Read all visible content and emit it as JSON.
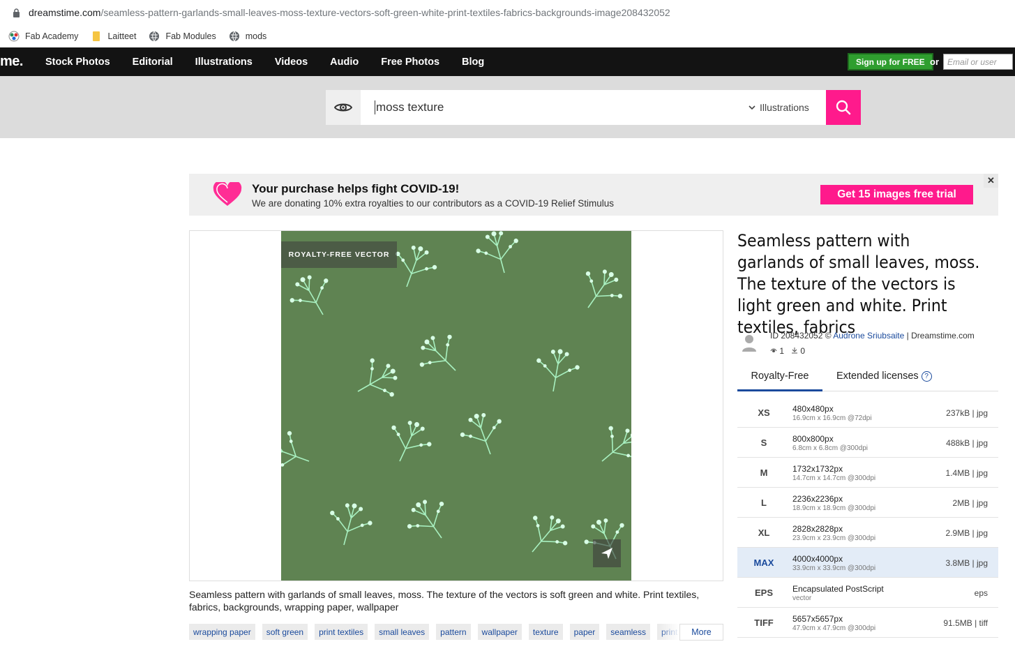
{
  "browser": {
    "url_host": "dreamstime.com",
    "url_path": "/seamless-pattern-garlands-small-leaves-moss-texture-vectors-soft-green-white-print-textiles-fabrics-backgrounds-image208432052",
    "bookmarks": [
      {
        "label": "Fab Academy",
        "icon": "fab-icon"
      },
      {
        "label": "Laitteet",
        "icon": "folder-icon"
      },
      {
        "label": "Fab Modules",
        "icon": "globe-icon"
      },
      {
        "label": "mods",
        "icon": "globe-icon"
      }
    ]
  },
  "nav": {
    "logo": "me.",
    "items": [
      "Stock Photos",
      "Editorial",
      "Illustrations",
      "Videos",
      "Audio",
      "Free Photos",
      "Blog"
    ],
    "signup_label": "Sign up for FREE",
    "or_label": "or",
    "email_placeholder": "Email or user"
  },
  "search": {
    "query": "moss texture",
    "category": "Illustrations"
  },
  "covid_banner": {
    "title": "Your purchase helps fight COVID-19!",
    "subtitle": "We are donating 10% extra royalties to our contributors as a COVID-19 Relief Stimulus",
    "cta": "Get 15 images free trial",
    "close": "✕"
  },
  "image": {
    "badge": "ROYALTY-FREE VECTOR",
    "caption": "Seamless pattern with garlands of small leaves, moss. The texture of the vectors is soft green and white. Print textiles, fabrics, backgrounds, wrapping paper, wallpaper",
    "tags": [
      "wrapping paper",
      "soft green",
      "print textiles",
      "small leaves",
      "pattern",
      "wallpaper",
      "texture",
      "paper",
      "seamless",
      "print"
    ],
    "more_label": "More"
  },
  "details": {
    "title": "Seamless pattern with garlands of small leaves, moss. The texture of the vectors is light green and white. Print textiles, fabrics",
    "id_prefix": "ID 208432052 ©",
    "author": "Audrone Sriubsaite",
    "site": "| Dreamstime.com",
    "views": "1",
    "downloads": "0",
    "tabs": [
      "Royalty-Free",
      "Extended licenses"
    ],
    "help": "?",
    "sizes": [
      {
        "code": "XS",
        "px": "480x480px",
        "cm": "16.9cm x 16.9cm @72dpi",
        "size": "237kB | jpg"
      },
      {
        "code": "S",
        "px": "800x800px",
        "cm": "6.8cm x 6.8cm @300dpi",
        "size": "488kB | jpg"
      },
      {
        "code": "M",
        "px": "1732x1732px",
        "cm": "14.7cm x 14.7cm @300dpi",
        "size": "1.4MB | jpg"
      },
      {
        "code": "L",
        "px": "2236x2236px",
        "cm": "18.9cm x 18.9cm @300dpi",
        "size": "2MB | jpg"
      },
      {
        "code": "XL",
        "px": "2828x2828px",
        "cm": "23.9cm x 23.9cm @300dpi",
        "size": "2.9MB | jpg"
      },
      {
        "code": "MAX",
        "px": "4000x4000px",
        "cm": "33.9cm x 33.9cm @300dpi",
        "size": "3.8MB | jpg"
      },
      {
        "code": "EPS",
        "px": "Encapsulated PostScript",
        "cm": "vector",
        "size": "eps"
      },
      {
        "code": "TIFF",
        "px": "5657x5657px",
        "cm": "47.9cm x 47.9cm @300dpi",
        "size": "91.5MB | tiff"
      }
    ]
  },
  "colors": {
    "accent_pink": "#ff1a8c",
    "link_blue": "#1a4a9c",
    "image_green": "#5f8352",
    "pattern_light": "#a8f0c0"
  }
}
